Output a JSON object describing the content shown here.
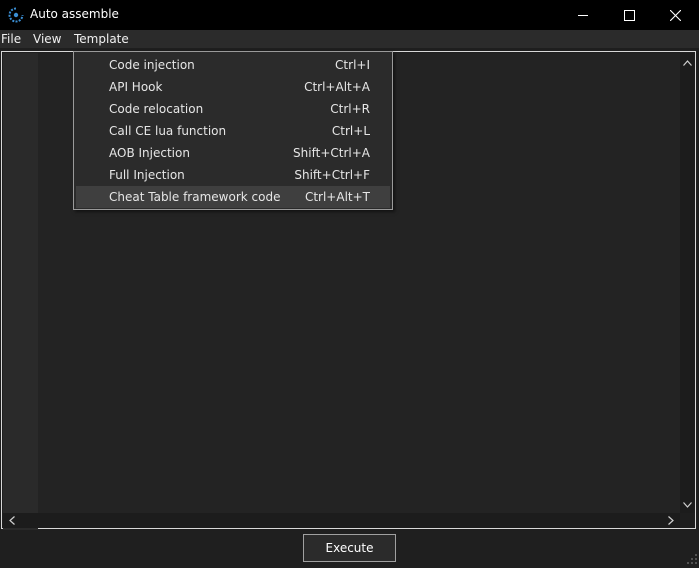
{
  "window": {
    "title": "Auto assemble",
    "icon": "cheat-engine-icon",
    "controls": [
      "minimize-icon",
      "maximize-icon",
      "close-icon"
    ]
  },
  "menubar": {
    "file": "File",
    "view": "View",
    "template": "Template"
  },
  "template_menu": {
    "items": [
      {
        "label": "Code injection",
        "shortcut": "Ctrl+I"
      },
      {
        "label": "API Hook",
        "shortcut": "Ctrl+Alt+A"
      },
      {
        "label": "Code relocation",
        "shortcut": "Ctrl+R"
      },
      {
        "label": "Call CE lua function",
        "shortcut": "Ctrl+L"
      },
      {
        "label": "AOB Injection",
        "shortcut": "Shift+Ctrl+A"
      },
      {
        "label": "Full Injection",
        "shortcut": "Shift+Ctrl+F"
      },
      {
        "label": "Cheat Table framework code",
        "shortcut": "Ctrl+Alt+T"
      }
    ],
    "highlighted_item": "Cheat Table framework code"
  },
  "editor": {
    "content": ""
  },
  "footer": {
    "execute_label": "Execute"
  },
  "colors": {
    "titlebar": "#000000",
    "menubar": "#2b2b2b",
    "editor_bg": "#232323",
    "gutter_bg": "#2a2a2a",
    "menu_bg": "#2b2b2b",
    "menu_highlight": "#3f3f3f",
    "text": "#e6e6e6"
  }
}
